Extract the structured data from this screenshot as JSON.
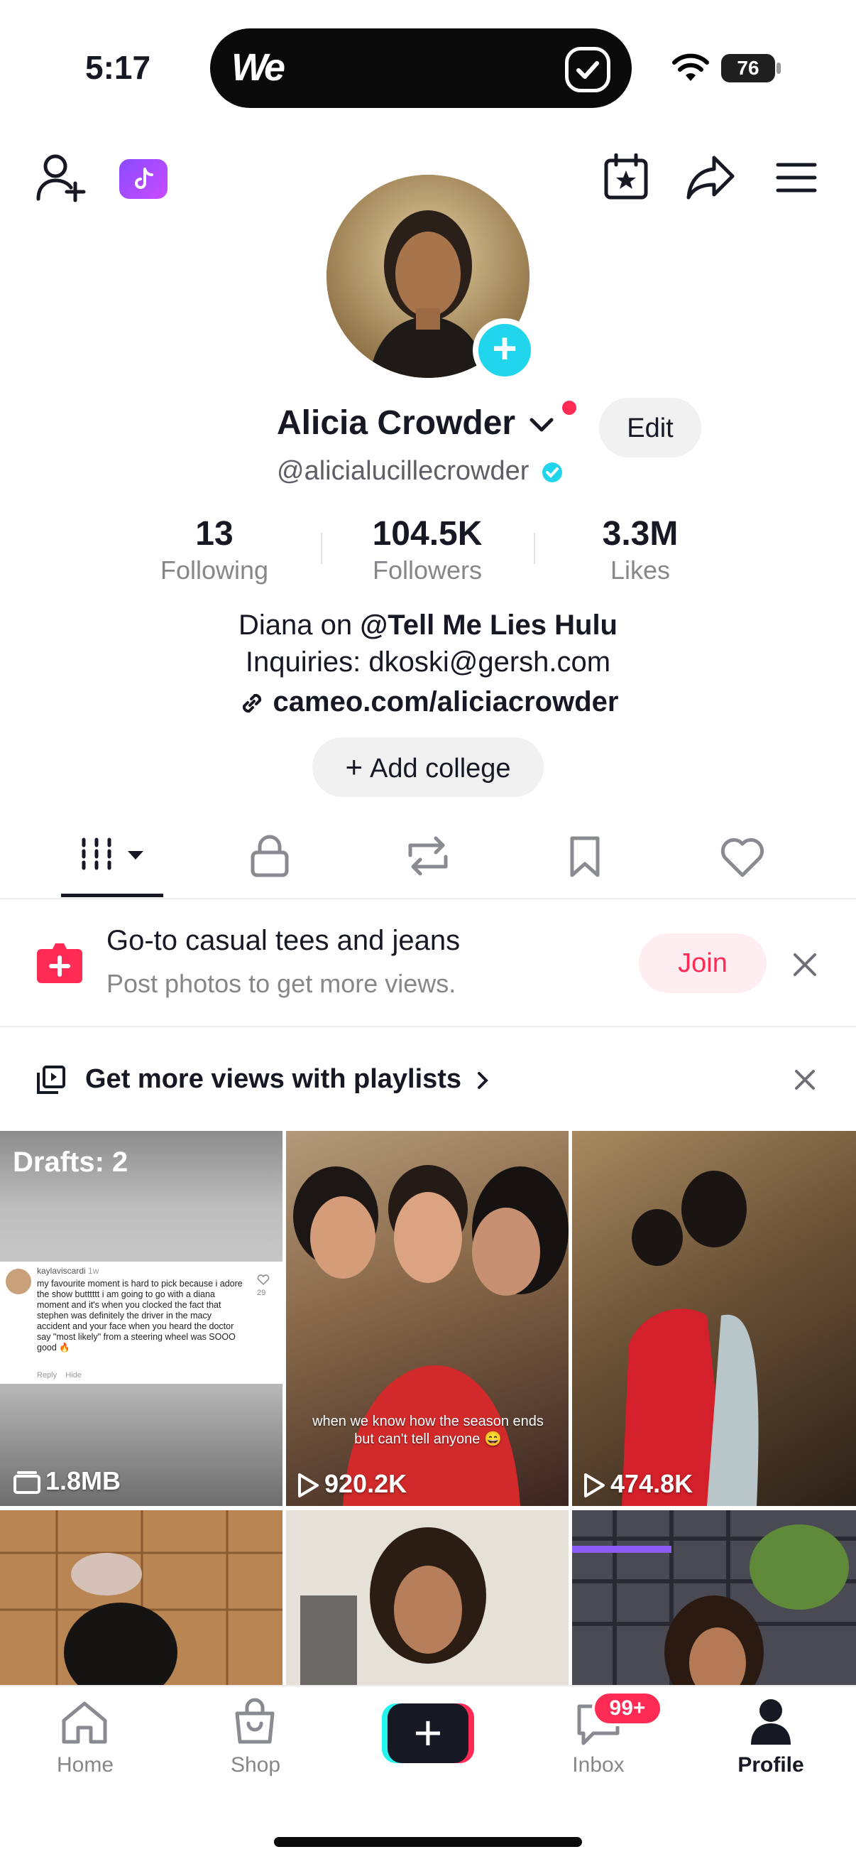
{
  "status_bar": {
    "time": "5:17",
    "battery": "76",
    "island_app": "We"
  },
  "colors": {
    "accent": "#fe2c55",
    "verified": "#20d5ec",
    "text": "#161823",
    "muted": "#86878b"
  },
  "header_icons": [
    "add-friend-icon",
    "tiktok-coins-icon",
    "calendar-star-icon",
    "share-icon",
    "menu-icon"
  ],
  "profile": {
    "name": "Alicia Crowder",
    "username": "@alicialucillecrowder",
    "edit_label": "Edit",
    "stats": [
      {
        "value": "13",
        "label": "Following"
      },
      {
        "value": "104.5K",
        "label": "Followers"
      },
      {
        "value": "3.3M",
        "label": "Likes"
      }
    ],
    "bio_line1_prefix": "Diana on ",
    "bio_line1_bold": "@Tell Me Lies Hulu",
    "bio_line2": "Inquiries: dkoski@gersh.com",
    "link": "cameo.com/aliciacrowder",
    "add_college": "Add college"
  },
  "tabs": [
    "videos-grid",
    "private",
    "reposts",
    "favorites",
    "liked"
  ],
  "promo": {
    "title": "Go-to casual tees and jeans",
    "subtitle": "Post photos to get more views.",
    "join_label": "Join"
  },
  "playlist_prompt": "Get more views with playlists",
  "grid": {
    "drafts_label": "Drafts: 2",
    "drafts_size": "1.8MB",
    "comment_user": "kaylaviscardi",
    "comment_age": "1w",
    "comment_text": "my favourite moment is hard to pick because i adore the show butttttt i am going to go with a diana moment and it's when you clocked the fact that stephen was definitely the driver in the macy accident and your face when you heard the doctor say \"most likely\" from a steering wheel was SOOO good 🔥",
    "comment_likes": "29",
    "comment_reply": "Reply",
    "comment_hide": "Hide",
    "tile2_caption": "when we know how the season ends but can't tell anyone 😄",
    "tile2_views": "920.2K",
    "tile3_views": "474.8K"
  },
  "nav": {
    "home": "Home",
    "shop": "Shop",
    "inbox": "Inbox",
    "inbox_badge": "99+",
    "profile": "Profile"
  }
}
